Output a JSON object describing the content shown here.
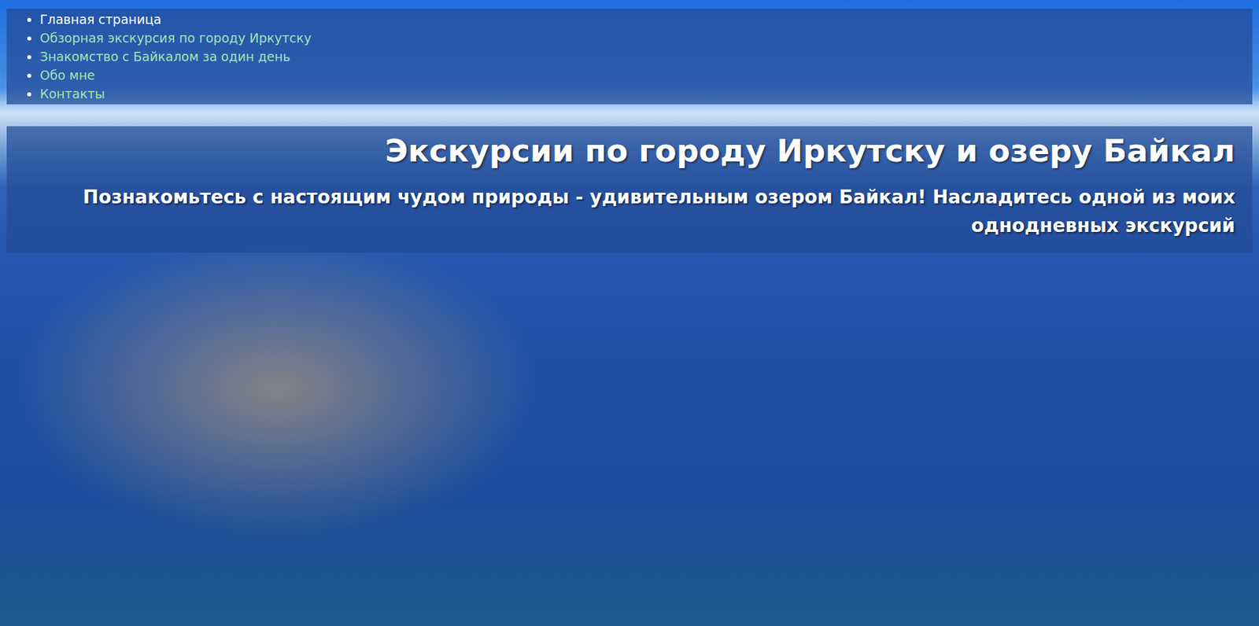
{
  "nav": {
    "items": [
      {
        "label": "Главная страница",
        "selected": true
      },
      {
        "label": "Обзорная экскурсия по городу Иркутску",
        "selected": false
      },
      {
        "label": "Знакомство с Байкалом за один день",
        "selected": false
      },
      {
        "label": "Обо мне",
        "selected": false
      },
      {
        "label": "Контакты",
        "selected": false
      }
    ]
  },
  "header": {
    "title": "Экскурсии по городу Иркутску и озеру Байкал",
    "subtitle": "Познакомьтесь с настоящим чудом природы - удивительным озером Байкал! Насладитесь одной из моих однодневных экскурсий"
  }
}
